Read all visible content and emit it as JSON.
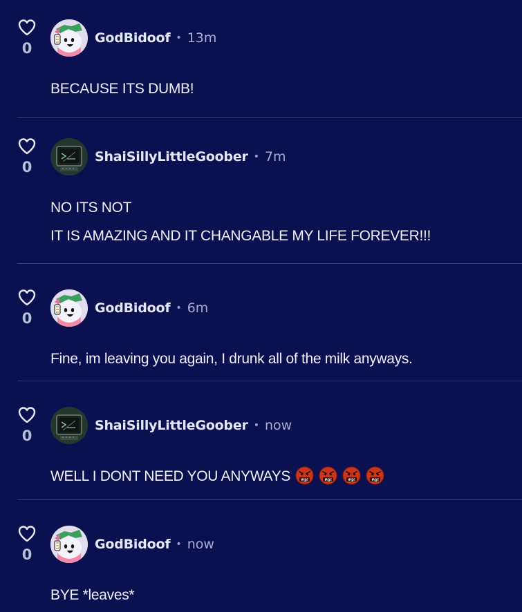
{
  "colors": {
    "background": "#0b1150",
    "divider": "#363d79",
    "username": "#e4e7f5",
    "timestamp": "#a9afd0",
    "angry_emoji": "#c8361c"
  },
  "comments": [
    {
      "likes": "0",
      "user": "GodBidoof",
      "avatar": "pink-creature-avatar",
      "time": "13m",
      "lines": [
        "BECAUSE ITS DUMB!"
      ]
    },
    {
      "likes": "0",
      "user": "ShaiSillyLittleGoober",
      "avatar": "retro-computer-avatar",
      "time": "7m",
      "lines": [
        "NO ITS NOT",
        "IT IS AMAZING AND IT CHANGABLE MY LIFE FOREVER!!!"
      ]
    },
    {
      "likes": "0",
      "user": "GodBidoof",
      "avatar": "pink-creature-avatar",
      "time": "6m",
      "lines": [
        "Fine, im leaving you again, I drunk all of the milk anyways."
      ]
    },
    {
      "likes": "0",
      "user": "ShaiSillyLittleGoober",
      "avatar": "retro-computer-avatar",
      "time": "now",
      "lines": [
        "WELL I DONT NEED YOU ANYWAYS"
      ],
      "emoji": [
        "angry-face-emoji",
        "angry-face-emoji",
        "angry-face-emoji",
        "angry-face-emoji"
      ]
    },
    {
      "likes": "0",
      "user": "GodBidoof",
      "avatar": "pink-creature-avatar",
      "time": "now",
      "lines": [
        "BYE *leaves*"
      ]
    }
  ],
  "separator": "•"
}
